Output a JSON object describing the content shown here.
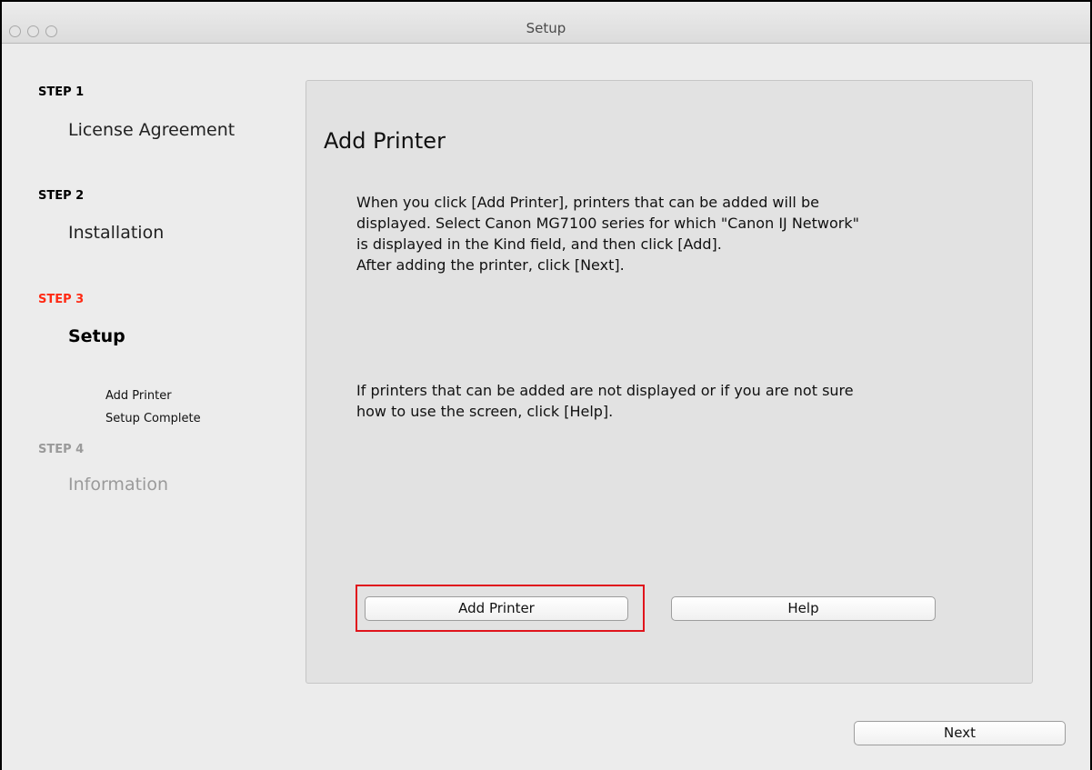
{
  "window": {
    "title": "Setup"
  },
  "sidebar": {
    "steps": [
      {
        "label": "STEP 1",
        "name": "License Agreement"
      },
      {
        "label": "STEP 2",
        "name": "Installation"
      },
      {
        "label": "STEP 3",
        "name": "Setup",
        "sub_items": [
          "Add Printer",
          "Setup Complete"
        ]
      },
      {
        "label": "STEP 4",
        "name": "Information"
      }
    ],
    "colors": {
      "active_step": "#ff2a14",
      "disabled": "#9a9a9a"
    }
  },
  "main": {
    "title": "Add Printer",
    "instructions": [
      "When you click [Add Printer], printers that can be added will be",
      "displayed. Select Canon MG7100 series for which \"Canon IJ Network\"",
      "is displayed in the Kind field, and then click [Add].",
      "After adding the printer, click [Next]."
    ],
    "help_text": [
      "If printers that can be added are not displayed or if you are not sure",
      "how to use the screen, click [Help]."
    ],
    "buttons": {
      "add_printer": "Add Printer",
      "help": "Help"
    },
    "highlight_color": "#e0141c"
  },
  "footer": {
    "next": "Next"
  }
}
